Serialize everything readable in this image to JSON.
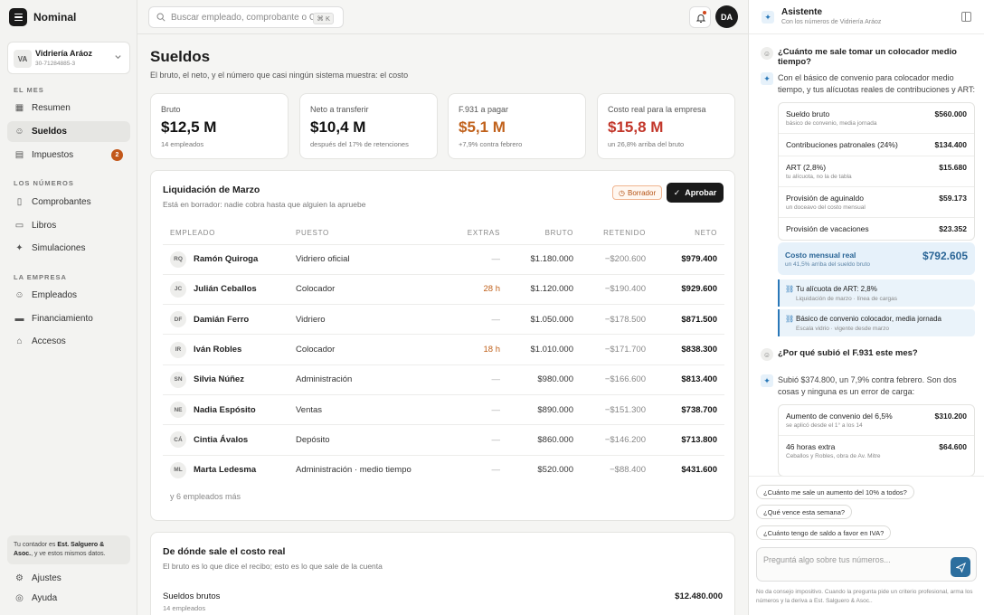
{
  "app": {
    "brand": "Nominal"
  },
  "org": {
    "initials": "VA",
    "name": "Vidriería Aráoz",
    "cuit": "30-71284885-3"
  },
  "sidebar": {
    "sec1": "EL MES",
    "sec2": "LOS NÚMEROS",
    "sec3": "LA EMPRESA",
    "items": [
      {
        "label": "Resumen"
      },
      {
        "label": "Sueldos"
      },
      {
        "label": "Impuestos",
        "badge": "2"
      },
      {
        "label": "Comprobantes"
      },
      {
        "label": "Libros"
      },
      {
        "label": "Simulaciones"
      },
      {
        "label": "Empleados"
      },
      {
        "label": "Financiamiento"
      },
      {
        "label": "Accesos"
      }
    ],
    "accountant_pre": "Tu contador es ",
    "accountant_name": "Est. Salguero & Asoc.",
    "accountant_post": ", y ve estos mismos datos.",
    "settings": "Ajustes",
    "help": "Ayuda"
  },
  "topbar": {
    "search_placeholder": "Buscar empleado, comprobante o CUIT",
    "shortcut": "⌘ K",
    "user_initials": "DA"
  },
  "page": {
    "title": "Sueldos",
    "subtitle": "El bruto, el neto, y el número que casi ningún sistema muestra: el costo"
  },
  "kpis": [
    {
      "label": "Bruto",
      "value": "$12,5 M",
      "foot": "14 empleados",
      "color": "#111111"
    },
    {
      "label": "Neto a transferir",
      "value": "$10,4 M",
      "foot": "después del 17% de retenciones",
      "color": "#111111"
    },
    {
      "label": "F.931 a pagar",
      "value": "$5,1 M",
      "foot": "+7,9% contra febrero",
      "color": "#c0611b"
    },
    {
      "label": "Costo real para la empresa",
      "value": "$15,8 M",
      "foot": "un 26,8% arriba del bruto",
      "color": "#c2362a"
    }
  ],
  "payroll": {
    "title": "Liquidación de Marzo",
    "subtitle": "Está en borrador: nadie cobra hasta que alguien la apruebe",
    "status": "Borrador",
    "approve": "Aprobar",
    "headers": {
      "employee": "EMPLEADO",
      "role": "PUESTO",
      "extras": "EXTRAS",
      "gross": "BRUTO",
      "withheld": "RETENIDO",
      "net": "NETO"
    },
    "rows": [
      {
        "ini": "RQ",
        "name": "Ramón Quiroga",
        "role": "Vidriero oficial",
        "extras": "—",
        "gross": "$1.180.000",
        "withheld": "−$200.600",
        "net": "$979.400"
      },
      {
        "ini": "JC",
        "name": "Julián Ceballos",
        "role": "Colocador",
        "extras": "28 h",
        "gross": "$1.120.000",
        "withheld": "−$190.400",
        "net": "$929.600"
      },
      {
        "ini": "DF",
        "name": "Damián Ferro",
        "role": "Vidriero",
        "extras": "—",
        "gross": "$1.050.000",
        "withheld": "−$178.500",
        "net": "$871.500"
      },
      {
        "ini": "IR",
        "name": "Iván Robles",
        "role": "Colocador",
        "extras": "18 h",
        "gross": "$1.010.000",
        "withheld": "−$171.700",
        "net": "$838.300"
      },
      {
        "ini": "SN",
        "name": "Silvia Núñez",
        "role": "Administración",
        "extras": "—",
        "gross": "$980.000",
        "withheld": "−$166.600",
        "net": "$813.400"
      },
      {
        "ini": "NE",
        "name": "Nadia Espósito",
        "role": "Ventas",
        "extras": "—",
        "gross": "$890.000",
        "withheld": "−$151.300",
        "net": "$738.700"
      },
      {
        "ini": "CÁ",
        "name": "Cintia Ávalos",
        "role": "Depósito",
        "extras": "—",
        "gross": "$860.000",
        "withheld": "−$146.200",
        "net": "$713.800"
      },
      {
        "ini": "ML",
        "name": "Marta Ledesma",
        "role": "Administración · medio tiempo",
        "extras": "—",
        "gross": "$520.000",
        "withheld": "−$88.400",
        "net": "$431.600"
      }
    ],
    "more": "y 6 empleados más"
  },
  "cost": {
    "title": "De dónde sale el costo real",
    "subtitle": "El bruto es lo que dice el recibo; esto es lo que sale de la cuenta",
    "row_label": "Sueldos brutos",
    "row_sub": "14 empleados",
    "row_value": "$12.480.000"
  },
  "assistant": {
    "title": "Asistente",
    "subtitle": "Con los números de Vidriería Aráoz",
    "q1": "¿Cuánto me sale tomar un colocador medio tiempo?",
    "a1": "Con el básico de convenio para colocador medio tiempo, y tus alícuotas reales de contribuciones y ART:",
    "breakdown": [
      {
        "label": "Sueldo bruto",
        "sub": "básico de convenio, media jornada",
        "value": "$560.000"
      },
      {
        "label": "Contribuciones patronales (24%)",
        "sub": "",
        "value": "$134.400"
      },
      {
        "label": "ART (2,8%)",
        "sub": "tu alícuota, no la de tabla",
        "value": "$15.680"
      },
      {
        "label": "Provisión de aguinaldo",
        "sub": "un doceavo del costo mensual",
        "value": "$59.173"
      },
      {
        "label": "Provisión de vacaciones",
        "sub": "",
        "value": "$23.352"
      }
    ],
    "total_label": "Costo mensual real",
    "total_sub": "un 41,5% arriba del sueldo bruto",
    "total_value": "$792.605",
    "sources": [
      {
        "label": "Tu alícuota de ART: 2,8%",
        "sub": "Liquidación de marzo · línea de cargas"
      },
      {
        "label": "Básico de convenio colocador, media jornada",
        "sub": "Escala vidrio · vigente desde marzo"
      }
    ],
    "q2": "¿Por qué subió el F.931 este mes?",
    "a2": "Subió $374.800, un 7,9% contra febrero. Son dos cosas y ninguna es un error de carga:",
    "breakdown2": [
      {
        "label": "Aumento de convenio del 6,5%",
        "sub": "se aplicó desde el 1° a los 14",
        "value": "$310.200"
      },
      {
        "label": "46 horas extra",
        "sub": "Ceballos y Robles, obra de Av. Mitre",
        "value": "$64.600"
      }
    ],
    "suggestions": [
      "¿Cuánto me sale un aumento del 10% a todos?",
      "¿Qué vence esta semana?",
      "¿Cuánto tengo de saldo a favor en IVA?"
    ],
    "input_placeholder": "Preguntá algo sobre tus números...",
    "disclaimer": "No da consejo impositivo. Cuando la pregunta pide un criterio profesional, arma los números y la deriva a Est. Salguero & Asoc.."
  }
}
